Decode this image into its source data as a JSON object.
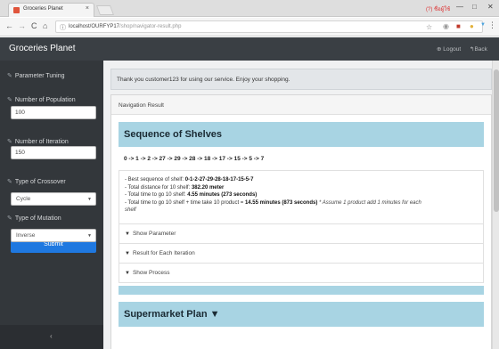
{
  "browser": {
    "tab_title": "Groceries Planet",
    "tab_close": "×",
    "profile_label": "(?) ชื่อผู้ใช้",
    "window_controls": [
      "—",
      "□",
      "✕"
    ],
    "url_host": "localhost/OURFYP17",
    "url_path": "/shop/navigator-result.php",
    "nav": {
      "back": "←",
      "forward": "→",
      "reload": "C",
      "home": "⌂",
      "info": "ⓘ"
    },
    "extensions": [
      "☆",
      "◉",
      "■",
      "●",
      "▼"
    ],
    "menu": "⋮"
  },
  "header": {
    "brand": "Groceries Planet",
    "logout_label": "⊕ Logout",
    "back_label": "↰Back"
  },
  "sidebar": {
    "section_title": "Parameter Tuning",
    "population_label": "Number of Population",
    "population_value": "100",
    "iteration_label": "Number of Iteration",
    "iteration_value": "150",
    "crossover_label": "Type of Crossover",
    "crossover_value": "Cycle",
    "mutation_label": "Type of Mutation",
    "mutation_value": "Inverse",
    "submit_label": "Submit",
    "collapse_icon": "‹"
  },
  "main": {
    "thanks": "Thank you customer123 for using our service. Enjoy your shopping.",
    "panel_title": "Navigation Result",
    "sequence_title": "Sequence of Shelves",
    "sequence": "0 -> 1 -> 2 -> 27 -> 29 -> 28 -> 18 -> 17 -> 15 -> 5 -> 7",
    "best_sequence_prefix": "- Best sequence of shelf: ",
    "best_sequence_value": "0-1-2-27-29-28-18-17-15-5-7",
    "distance_prefix": "- Total distance for 10 shelf: ",
    "distance_value": "382.20 meter",
    "time_prefix": "- Total time to go 10 shelf: ",
    "time_value": "4.55 minutes (273 seconds)",
    "time_product_prefix": "- Total time to go 10 shelf + time take 10 product = ",
    "time_product_value": "14.55 minutes (873 seconds)",
    "assumption_a": "* Assume 1 product add 1 minutes for each",
    "assumption_b": "shelf",
    "show_parameter": "Show Parameter",
    "result_each_iteration": "Result for Each Iteration",
    "show_process": "Show Process",
    "plan_title": "Supermarket Plan ",
    "plan_chevron": "▼"
  }
}
